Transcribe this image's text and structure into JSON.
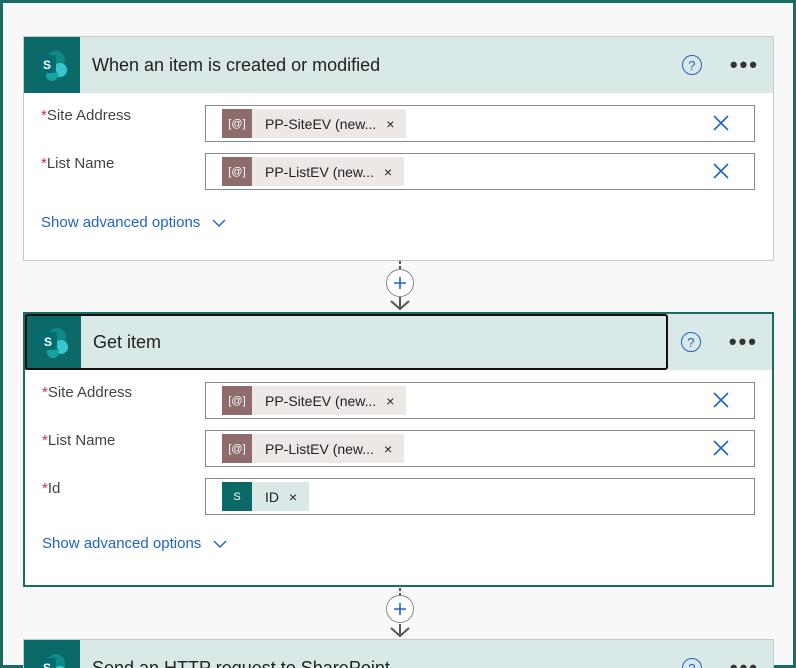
{
  "colors": {
    "accent": "#1f63c6",
    "brand": "#0b6a67",
    "header_bg": "#d9e9e7",
    "token_bg": "#ede7e6",
    "required": "#c4314b"
  },
  "cards": [
    {
      "title": "When an item is created or modified",
      "logo_letter": "S",
      "help_glyph": "?",
      "more_glyph": "•••",
      "fields": [
        {
          "label": "Site Address",
          "token": "PP-SiteEV (new...",
          "token_icon": "[@]"
        },
        {
          "label": "List Name",
          "token": "PP-ListEV (new...",
          "token_icon": "[@]"
        }
      ],
      "advanced": "Show advanced options"
    },
    {
      "title": "Get item",
      "logo_letter": "S",
      "help_glyph": "?",
      "more_glyph": "•••",
      "fields": [
        {
          "label": "Site Address",
          "token": "PP-SiteEV (new...",
          "token_icon": "[@]"
        },
        {
          "label": "List Name",
          "token": "PP-ListEV (new...",
          "token_icon": "[@]"
        },
        {
          "label": "Id",
          "token": "ID",
          "token_icon": "S"
        }
      ],
      "advanced": "Show advanced options"
    },
    {
      "title": "Send an HTTP request to SharePoint",
      "logo_letter": "S",
      "help_glyph": "?",
      "more_glyph": "•••"
    }
  ],
  "required_mark": "*",
  "token_close": "×"
}
